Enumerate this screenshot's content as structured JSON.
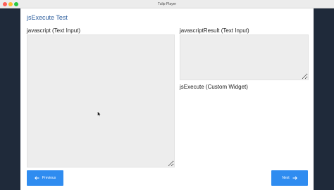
{
  "window": {
    "title": "Tulip Player"
  },
  "page": {
    "title": "jsExecute Test"
  },
  "widgets": {
    "javascript_label": "javascript (Text Input)",
    "javascript_value": "",
    "result_label": "javascriptResult (Text Input)",
    "result_value": "",
    "custom_widget_label": "jsExecute (Custom Widget)"
  },
  "navigation": {
    "previous_label": "Previous",
    "next_label": "Next"
  },
  "icons": {
    "previous": "arrow-left-icon",
    "next": "arrow-right-icon",
    "cursor": "mouse-pointer-icon"
  },
  "colors": {
    "accent": "#2f8cf0",
    "title": "#2e5f9e",
    "input_background": "#ededed",
    "sidebar": "#1f2a3a"
  }
}
